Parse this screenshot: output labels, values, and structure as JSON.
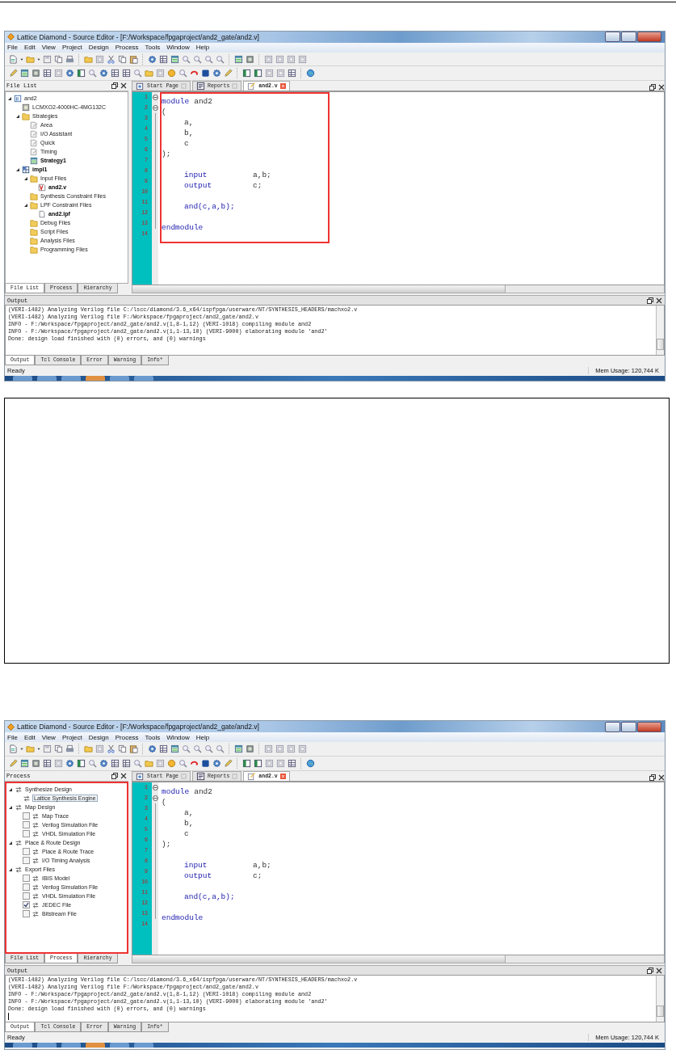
{
  "windows": [
    {
      "title": "Lattice Diamond - Source Editor - [F:/Workspace/fpgaproject/and2_gate/and2.v]",
      "menu": [
        "File",
        "Edit",
        "View",
        "Project",
        "Design",
        "Process",
        "Tools",
        "Window",
        "Help"
      ],
      "left_panel": {
        "title": "File List",
        "highlighted": false,
        "tree": [
          {
            "label": "and2",
            "kind": "project",
            "active": false,
            "expanded": true,
            "children": [
              {
                "label": "LCMXO2-4000HC-4MG132C",
                "kind": "device",
                "active": false
              },
              {
                "label": "Strategies",
                "kind": "folder",
                "active": false,
                "expanded": true,
                "children": [
                  {
                    "label": "Area",
                    "kind": "strategy",
                    "active": false
                  },
                  {
                    "label": "I/O Assistant",
                    "kind": "strategy",
                    "active": false
                  },
                  {
                    "label": "Quick",
                    "kind": "strategy",
                    "active": false
                  },
                  {
                    "label": "Timing",
                    "kind": "strategy",
                    "active": false
                  },
                  {
                    "label": "Strategy1",
                    "kind": "strategy_set",
                    "active": true
                  }
                ]
              },
              {
                "label": "impl1",
                "kind": "implementation",
                "active": true,
                "expanded": true,
                "children": [
                  {
                    "label": "Input Files",
                    "kind": "folder",
                    "active": false,
                    "expanded": true,
                    "children": [
                      {
                        "label": "and2.v",
                        "kind": "verilog",
                        "active": true
                      }
                    ]
                  },
                  {
                    "label": "Synthesis Constraint Files",
                    "kind": "folder",
                    "active": false
                  },
                  {
                    "label": "LPF Constraint Files",
                    "kind": "folder",
                    "active": false,
                    "expanded": true,
                    "children": [
                      {
                        "label": "and2.lpf",
                        "kind": "file",
                        "active": true
                      }
                    ]
                  },
                  {
                    "label": "Debug Files",
                    "kind": "folder",
                    "active": false
                  },
                  {
                    "label": "Script Files",
                    "kind": "folder",
                    "active": false
                  },
                  {
                    "label": "Analysis Files",
                    "kind": "folder",
                    "active": false
                  },
                  {
                    "label": "Programming Files",
                    "kind": "folder",
                    "active": false
                  }
                ]
              }
            ]
          }
        ]
      },
      "left_tabs": [
        {
          "label": "File List",
          "selected": true
        },
        {
          "label": "Process",
          "selected": false
        },
        {
          "label": "Hierarchy",
          "selected": false
        }
      ],
      "editor_tabs": [
        {
          "label": "Start Page",
          "kind": "home",
          "selected": false
        },
        {
          "label": "Reports",
          "kind": "report",
          "selected": false
        },
        {
          "label": "and2.v",
          "kind": "source",
          "selected": true
        }
      ],
      "editor_highlighted": true,
      "code_lines": [
        {
          "number": "1",
          "fold": true,
          "indented": false,
          "tokens": [
            {
              "text": "module",
              "kind": "keyword"
            },
            {
              "text": "and2",
              "kind": "plain"
            }
          ]
        },
        {
          "number": "2",
          "fold": true,
          "indented": false,
          "tokens": [
            {
              "text": "(",
              "kind": "plain"
            }
          ]
        },
        {
          "number": "3",
          "indented": true,
          "tokens": [
            {
              "text": "a,",
              "kind": "plain"
            }
          ]
        },
        {
          "number": "4",
          "indented": true,
          "tokens": [
            {
              "text": "b,",
              "kind": "plain"
            }
          ]
        },
        {
          "number": "5",
          "indented": true,
          "tokens": [
            {
              "text": "c",
              "kind": "plain"
            }
          ]
        },
        {
          "number": "6",
          "indented": false,
          "tokens": [
            {
              "text": ");",
              "kind": "plain"
            }
          ]
        },
        {
          "number": "7"
        },
        {
          "number": "8",
          "indented": true,
          "tokens": [
            {
              "text": "input",
              "kind": "keyword"
            },
            {
              "text": "a,b;",
              "kind": "plain"
            }
          ]
        },
        {
          "number": "9",
          "indented": true,
          "tokens": [
            {
              "text": "output",
              "kind": "keyword"
            },
            {
              "text": "c;",
              "kind": "plain"
            }
          ]
        },
        {
          "number": "10"
        },
        {
          "number": "11",
          "indented": true,
          "tokens": [
            {
              "text": "and(c,a,b);",
              "kind": "keyword"
            }
          ]
        },
        {
          "number": "12"
        },
        {
          "number": "13",
          "indented": false,
          "tokens": [
            {
              "text": "endmodule",
              "kind": "keyword"
            }
          ]
        },
        {
          "number": "14"
        }
      ],
      "output_title": "Output",
      "output_lines": [
        "(VERI-1482) Analyzing Verilog file C:/lscc/diamond/3.6_x64/ispfpga/userware/NT/SYNTHESIS_HEADERS/machxo2.v",
        "(VERI-1482) Analyzing Verilog file F:/Workspace/fpgaproject/and2_gate/and2.v",
        "INFO - F:/Workspace/fpgaproject/and2_gate/and2.v(1,8-1,12) (VERI-1018) compiling module and2",
        "INFO - F:/Workspace/fpgaproject/and2_gate/and2.v(1,1-13,10) (VERI-9000) elaborating module 'and2'",
        "Done: design load finished with (0) errors, and (0) warnings"
      ],
      "output_cursor": false,
      "output_tabs": [
        {
          "label": "Output",
          "selected": true
        },
        {
          "label": "Tcl Console",
          "selected": false
        },
        {
          "label": "Error",
          "selected": false
        },
        {
          "label": "Warning",
          "selected": false
        },
        {
          "label": "Info*",
          "selected": false
        }
      ],
      "status": "Ready",
      "memory": "Mem Usage: 120,744 K"
    },
    {
      "title": "Lattice Diamond - Source Editor - [F:/Workspace/fpgaproject/and2_gate/and2.v]",
      "menu": [
        "File",
        "Edit",
        "View",
        "Project",
        "Design",
        "Process",
        "Tools",
        "Window",
        "Help"
      ],
      "left_panel": {
        "title": "Process",
        "highlighted": true,
        "tree": [
          {
            "label": "Synthesize Design",
            "kind": "process",
            "active": false,
            "selected": false,
            "expanded": true,
            "children": [
              {
                "label": "Lattice Synthesis Engine",
                "kind": "process",
                "active": false,
                "selected": true
              }
            ]
          },
          {
            "label": "Map Design",
            "kind": "process",
            "active": false,
            "selected": false,
            "expanded": true,
            "children": [
              {
                "label": "Map Trace",
                "kind": "process",
                "active": false,
                "selected": false,
                "checked": false
              },
              {
                "label": "Verilog Simulation File",
                "kind": "process",
                "active": false,
                "selected": false,
                "checked": false
              },
              {
                "label": "VHDL Simulation File",
                "kind": "process",
                "active": false,
                "selected": false,
                "checked": false
              }
            ]
          },
          {
            "label": "Place & Route Design",
            "kind": "process",
            "active": false,
            "selected": false,
            "expanded": true,
            "children": [
              {
                "label": "Place & Route Trace",
                "kind": "process",
                "active": false,
                "selected": false,
                "checked": false
              },
              {
                "label": "I/O Timing Analysis",
                "kind": "process",
                "active": false,
                "selected": false,
                "checked": false
              }
            ]
          },
          {
            "label": "Export Files",
            "kind": "process",
            "active": false,
            "selected": false,
            "expanded": true,
            "children": [
              {
                "label": "IBIS Model",
                "kind": "process",
                "active": false,
                "selected": false,
                "checked": false
              },
              {
                "label": "Verilog Simulation File",
                "kind": "process",
                "active": false,
                "selected": false,
                "checked": false
              },
              {
                "label": "VHDL Simulation File",
                "kind": "process",
                "active": false,
                "selected": false,
                "checked": false
              },
              {
                "label": "JEDEC File",
                "kind": "process",
                "active": false,
                "selected": false,
                "checked": true
              },
              {
                "label": "Bitstream File",
                "kind": "process",
                "active": false,
                "selected": false,
                "checked": false
              }
            ]
          }
        ]
      },
      "left_tabs": [
        {
          "label": "File List",
          "selected": false
        },
        {
          "label": "Process",
          "selected": true
        },
        {
          "label": "Hierarchy",
          "selected": false
        }
      ],
      "editor_tabs": [
        {
          "label": "Start Page",
          "kind": "home",
          "selected": false
        },
        {
          "label": "Reports",
          "kind": "report",
          "selected": false
        },
        {
          "label": "and2.v",
          "kind": "source",
          "selected": true
        }
      ],
      "editor_highlighted": false,
      "code_lines": [
        {
          "number": "1",
          "fold": true,
          "indented": false,
          "tokens": [
            {
              "text": "module",
              "kind": "keyword"
            },
            {
              "text": "and2",
              "kind": "plain"
            }
          ]
        },
        {
          "number": "2",
          "fold": true,
          "indented": false,
          "tokens": [
            {
              "text": "(",
              "kind": "plain"
            }
          ]
        },
        {
          "number": "3",
          "indented": true,
          "tokens": [
            {
              "text": "a,",
              "kind": "plain"
            }
          ]
        },
        {
          "number": "4",
          "indented": true,
          "tokens": [
            {
              "text": "b,",
              "kind": "plain"
            }
          ]
        },
        {
          "number": "5",
          "indented": true,
          "tokens": [
            {
              "text": "c",
              "kind": "plain"
            }
          ]
        },
        {
          "number": "6",
          "indented": false,
          "tokens": [
            {
              "text": ");",
              "kind": "plain"
            }
          ]
        },
        {
          "number": "7"
        },
        {
          "number": "8",
          "indented": true,
          "tokens": [
            {
              "text": "input",
              "kind": "keyword"
            },
            {
              "text": "a,b;",
              "kind": "plain"
            }
          ]
        },
        {
          "number": "9",
          "indented": true,
          "tokens": [
            {
              "text": "output",
              "kind": "keyword"
            },
            {
              "text": "c;",
              "kind": "plain"
            }
          ]
        },
        {
          "number": "10"
        },
        {
          "number": "11",
          "indented": true,
          "tokens": [
            {
              "text": "and(c,a,b);",
              "kind": "keyword"
            }
          ]
        },
        {
          "number": "12"
        },
        {
          "number": "13",
          "indented": false,
          "tokens": [
            {
              "text": "endmodule",
              "kind": "keyword"
            }
          ]
        },
        {
          "number": "14"
        }
      ],
      "output_title": "Output",
      "output_lines": [
        "(VERI-1482) Analyzing Verilog file C:/lscc/diamond/3.6_x64/ispfpga/userware/NT/SYNTHESIS_HEADERS/machxo2.v",
        "(VERI-1482) Analyzing Verilog file F:/Workspace/fpgaproject/and2_gate/and2.v",
        "INFO - F:/Workspace/fpgaproject/and2_gate/and2.v(1,8-1,12) (VERI-1018) compiling module and2",
        "INFO - F:/Workspace/fpgaproject/and2_gate/and2.v(1,1-13,10) (VERI-9000) elaborating module 'and2'",
        "Done: design load finished with (0) errors, and (0) warnings"
      ],
      "output_cursor": true,
      "output_tabs": [
        {
          "label": "Output",
          "selected": true
        },
        {
          "label": "Tcl Console",
          "selected": false
        },
        {
          "label": "Error",
          "selected": false
        },
        {
          "label": "Warning",
          "selected": false
        },
        {
          "label": "Info*",
          "selected": false
        }
      ],
      "status": "Ready",
      "memory": "Mem Usage: 120,744 K"
    }
  ]
}
